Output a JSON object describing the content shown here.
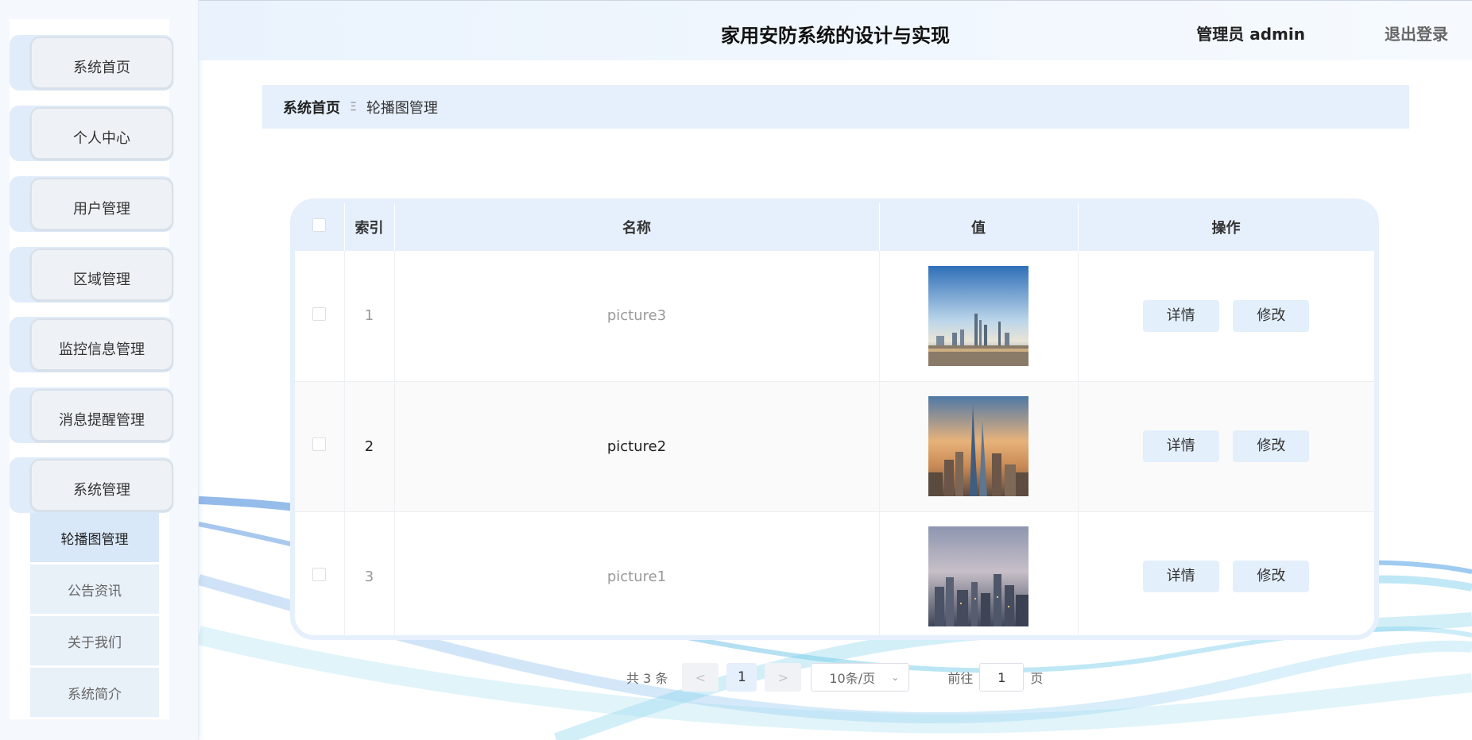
{
  "header": {
    "title": "家用安防系统的设计与实现",
    "user": "管理员 admin",
    "logout": "退出登录"
  },
  "sidebar": {
    "items": [
      {
        "label": "系统首页"
      },
      {
        "label": "个人中心"
      },
      {
        "label": "用户管理"
      },
      {
        "label": "区域管理"
      },
      {
        "label": "监控信息管理"
      },
      {
        "label": "消息提醒管理"
      },
      {
        "label": "系统管理"
      }
    ],
    "submenu": [
      {
        "label": "轮播图管理",
        "active": true
      },
      {
        "label": "公告资讯"
      },
      {
        "label": "关于我们"
      },
      {
        "label": "系统简介"
      }
    ]
  },
  "breadcrumb": {
    "home": "系统首页",
    "separator": "Ξ",
    "current": "轮播图管理"
  },
  "table": {
    "headers": {
      "index": "索引",
      "name": "名称",
      "value": "值",
      "actions": "操作"
    },
    "rows": [
      {
        "index": "1",
        "name": "picture3",
        "image": "city-skyline-thumbnail"
      },
      {
        "index": "2",
        "name": "picture2",
        "image": "skyscraper-sunset-thumbnail"
      },
      {
        "index": "3",
        "name": "picture1",
        "image": "city-dusk-thumbnail"
      }
    ],
    "detail_label": "详情",
    "edit_label": "修改"
  },
  "pagination": {
    "total": "共 3 条",
    "prev": "<",
    "page": "1",
    "next": ">",
    "page_size": "10条/页",
    "goto_label": "前往",
    "goto_value": "1",
    "page_unit": "页"
  },
  "colors": {
    "accent_light": "#e6f0fc",
    "button_bg": "#e3effb",
    "wave": "#5fc3e4"
  }
}
